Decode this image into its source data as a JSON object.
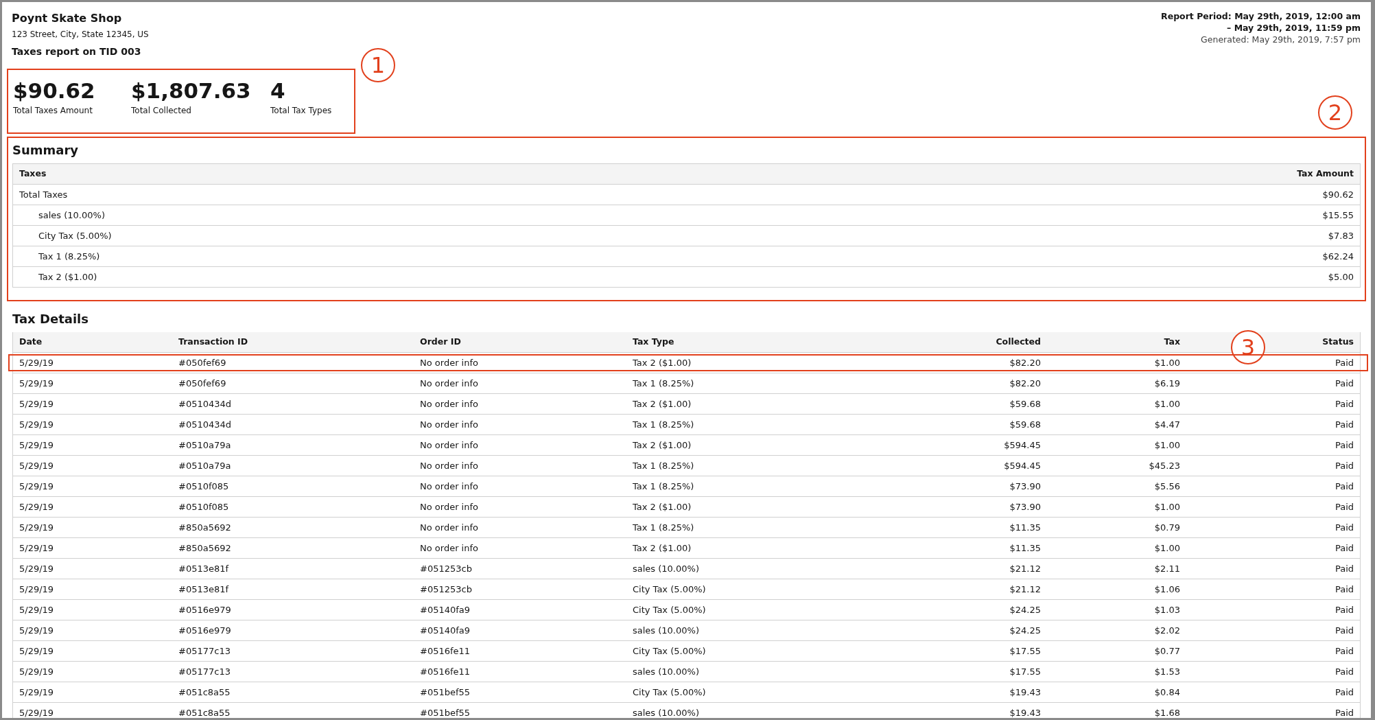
{
  "header": {
    "shop_name": "Poynt Skate Shop",
    "address": "123 Street, City, State 12345, US",
    "report_title": "Taxes report on TID 003",
    "report_period": [
      "Report Period: May 29th, 2019, 12:00 am",
      "– May 29th, 2019, 11:59 pm"
    ],
    "generated": "Generated: May 29th, 2019, 7:57 pm"
  },
  "stats": {
    "callout": "1",
    "items": [
      {
        "value": "$90.62",
        "label": "Total Taxes Amount"
      },
      {
        "value": "$1,807.63",
        "label": "Total Collected"
      },
      {
        "value": "4",
        "label": "Total Tax Types"
      }
    ]
  },
  "summary": {
    "title": "Summary",
    "callout": "2",
    "columns": [
      "Taxes",
      "Tax Amount"
    ],
    "rows": [
      {
        "name": "Total Taxes",
        "amount": "$90.62",
        "children": [
          {
            "name": "sales (10.00%)",
            "amount": "$15.55"
          },
          {
            "name": "City Tax (5.00%)",
            "amount": "$7.83"
          },
          {
            "name": "Tax 1 (8.25%)",
            "amount": "$62.24"
          },
          {
            "name": "Tax 2 ($1.00)",
            "amount": "$5.00"
          }
        ]
      }
    ]
  },
  "tax_details": {
    "title": "Tax Details",
    "callout": "3",
    "columns": [
      "Date",
      "Transaction ID",
      "Order ID",
      "Tax Type",
      "Collected",
      "Tax",
      "Status"
    ],
    "rows": [
      {
        "highlighted": true,
        "cells": [
          "5/29/19",
          "#050fef69",
          "No order info",
          "Tax 2 ($1.00)",
          "$82.20",
          "$1.00",
          "Paid"
        ]
      },
      {
        "highlighted": false,
        "cells": [
          "5/29/19",
          "#050fef69",
          "No order info",
          "Tax 1 (8.25%)",
          "$82.20",
          "$6.19",
          "Paid"
        ]
      },
      {
        "highlighted": false,
        "cells": [
          "5/29/19",
          "#0510434d",
          "No order info",
          "Tax 2 ($1.00)",
          "$59.68",
          "$1.00",
          "Paid"
        ]
      },
      {
        "highlighted": false,
        "cells": [
          "5/29/19",
          "#0510434d",
          "No order info",
          "Tax 1 (8.25%)",
          "$59.68",
          "$4.47",
          "Paid"
        ]
      },
      {
        "highlighted": false,
        "cells": [
          "5/29/19",
          "#0510a79a",
          "No order info",
          "Tax 2 ($1.00)",
          "$594.45",
          "$1.00",
          "Paid"
        ]
      },
      {
        "highlighted": false,
        "cells": [
          "5/29/19",
          "#0510a79a",
          "No order info",
          "Tax 1 (8.25%)",
          "$594.45",
          "$45.23",
          "Paid"
        ]
      },
      {
        "highlighted": false,
        "cells": [
          "5/29/19",
          "#0510f085",
          "No order info",
          "Tax 1 (8.25%)",
          "$73.90",
          "$5.56",
          "Paid"
        ]
      },
      {
        "highlighted": false,
        "cells": [
          "5/29/19",
          "#0510f085",
          "No order info",
          "Tax 2 ($1.00)",
          "$73.90",
          "$1.00",
          "Paid"
        ]
      },
      {
        "highlighted": false,
        "cells": [
          "5/29/19",
          "#850a5692",
          "No order info",
          "Tax 1 (8.25%)",
          "$11.35",
          "$0.79",
          "Paid"
        ]
      },
      {
        "highlighted": false,
        "cells": [
          "5/29/19",
          "#850a5692",
          "No order info",
          "Tax 2 ($1.00)",
          "$11.35",
          "$1.00",
          "Paid"
        ]
      },
      {
        "highlighted": false,
        "cells": [
          "5/29/19",
          "#0513e81f",
          "#051253cb",
          "sales (10.00%)",
          "$21.12",
          "$2.11",
          "Paid"
        ]
      },
      {
        "highlighted": false,
        "cells": [
          "5/29/19",
          "#0513e81f",
          "#051253cb",
          "City Tax (5.00%)",
          "$21.12",
          "$1.06",
          "Paid"
        ]
      },
      {
        "highlighted": false,
        "cells": [
          "5/29/19",
          "#0516e979",
          "#05140fa9",
          "City Tax (5.00%)",
          "$24.25",
          "$1.03",
          "Paid"
        ]
      },
      {
        "highlighted": false,
        "cells": [
          "5/29/19",
          "#0516e979",
          "#05140fa9",
          "sales (10.00%)",
          "$24.25",
          "$2.02",
          "Paid"
        ]
      },
      {
        "highlighted": false,
        "cells": [
          "5/29/19",
          "#05177c13",
          "#0516fe11",
          "City Tax (5.00%)",
          "$17.55",
          "$0.77",
          "Paid"
        ]
      },
      {
        "highlighted": false,
        "cells": [
          "5/29/19",
          "#05177c13",
          "#0516fe11",
          "sales (10.00%)",
          "$17.55",
          "$1.53",
          "Paid"
        ]
      },
      {
        "highlighted": false,
        "cells": [
          "5/29/19",
          "#051c8a55",
          "#051bef55",
          "City Tax (5.00%)",
          "$19.43",
          "$0.84",
          "Paid"
        ]
      },
      {
        "highlighted": false,
        "cells": [
          "5/29/19",
          "#051c8a55",
          "#051bef55",
          "sales (10.00%)",
          "$19.43",
          "$1.68",
          "Paid"
        ]
      }
    ]
  }
}
